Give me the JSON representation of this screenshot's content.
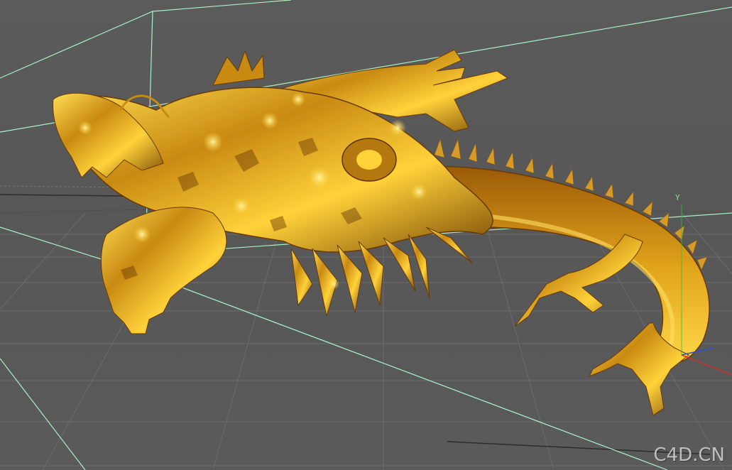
{
  "viewport": {
    "watermark": "C4D.CN",
    "axis_y_label": "Y"
  },
  "colors": {
    "background": "#5a5a5a",
    "grid_line": "#6a6a6a",
    "guide_line": "#a8f0c6",
    "gold_dark": "#7a4a06",
    "gold_mid": "#c98a12",
    "gold_light": "#ffd23a",
    "axis_x": "#d03030",
    "axis_y": "#30c030",
    "axis_z": "#3050d0"
  },
  "scene": {
    "object": "dragon-model",
    "material": "gold-reflective"
  }
}
